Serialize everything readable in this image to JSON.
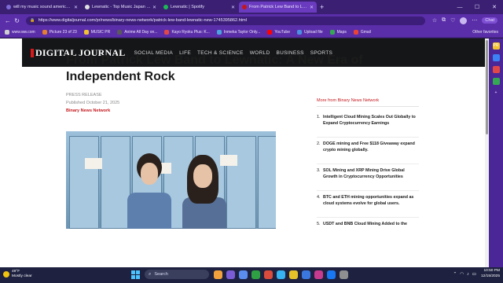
{
  "browser": {
    "tabs": [
      {
        "label": "will my music sound american?",
        "color": "#7d6bd6",
        "active": false
      },
      {
        "label": "Lewnatic - Top Music Japan - Artist",
        "color": "#e0e0e0",
        "active": false
      },
      {
        "label": "Lewnatic | Spotify",
        "color": "#1db954",
        "active": false
      },
      {
        "label": "From Patrick Lew Band to Lewnatic",
        "color": "#c4171c",
        "active": true
      }
    ],
    "url": "https://www.digitaljournal.com/pr/news/binary-news-network/patrick-lew-band-lewnatic-new-1745395862.html",
    "chat_label": "Chat",
    "bookmarks": [
      {
        "label": "www.ww.com",
        "color": "#cfcfcf"
      },
      {
        "label": "Picture 23 of 23",
        "color": "#e57f2e"
      },
      {
        "label": "MUSIC PR",
        "color": "#f2c230"
      },
      {
        "label": "Anime All Day on...",
        "color": "#5a5a5a"
      },
      {
        "label": "Kayo Ryoku Plus: K...",
        "color": "#e04848"
      },
      {
        "label": "Inmeka Taylor Only...",
        "color": "#4aa3df"
      },
      {
        "label": "YouTube",
        "color": "#ff0000"
      },
      {
        "label": "Upload file",
        "color": "#4a90e2"
      },
      {
        "label": "Maps",
        "color": "#34a853"
      },
      {
        "label": "Gmail",
        "color": "#ea4335"
      }
    ],
    "other_favorites": "Other favorites"
  },
  "site": {
    "logo": "DIGITAL JOURNAL",
    "nav": [
      "SOCIAL MEDIA",
      "LIFE",
      "TECH & SCIENCE",
      "WORLD",
      "BUSINESS",
      "SPORTS"
    ]
  },
  "article": {
    "title": "From Patrick Lew Band to Lewnatic: A New Era of Independent Rock",
    "label": "PRESS RELEASE",
    "published": "Published October 21, 2025",
    "source": "Binary News Network"
  },
  "sidebar": {
    "heading": "More from Binary News Network",
    "items": [
      {
        "num": "1.",
        "text": "Intelligent Cloud Mining Scales Out Globally to Expand Cryptocurrency Earnings"
      },
      {
        "num": "2.",
        "text": "DOGE mining and Free $118 Giveaway expand crypto mining globally."
      },
      {
        "num": "3.",
        "text": "SOL Mining and XRP Mining Drive Global Growth in Cryptocurrency Opportunities"
      },
      {
        "num": "4.",
        "text": "BTC and ETH mining opportunities expand as cloud systems evolve for global users."
      },
      {
        "num": "5.",
        "text": "USDT and BNB Cloud Mining Added to the"
      }
    ]
  },
  "taskbar": {
    "weather_temp": "49°F",
    "weather_desc": "Mostly clear",
    "search_placeholder": "Search",
    "time": "10:50 PM",
    "date": "12/15/2025",
    "apps": [
      "#f2a23c",
      "#7a5cd6",
      "#5b8def",
      "#2ea043",
      "#d94c3d",
      "#36b3f0",
      "#e6c229",
      "#3a78e0",
      "#c73b8f",
      "#1877f2",
      "#8f8f8f"
    ]
  }
}
